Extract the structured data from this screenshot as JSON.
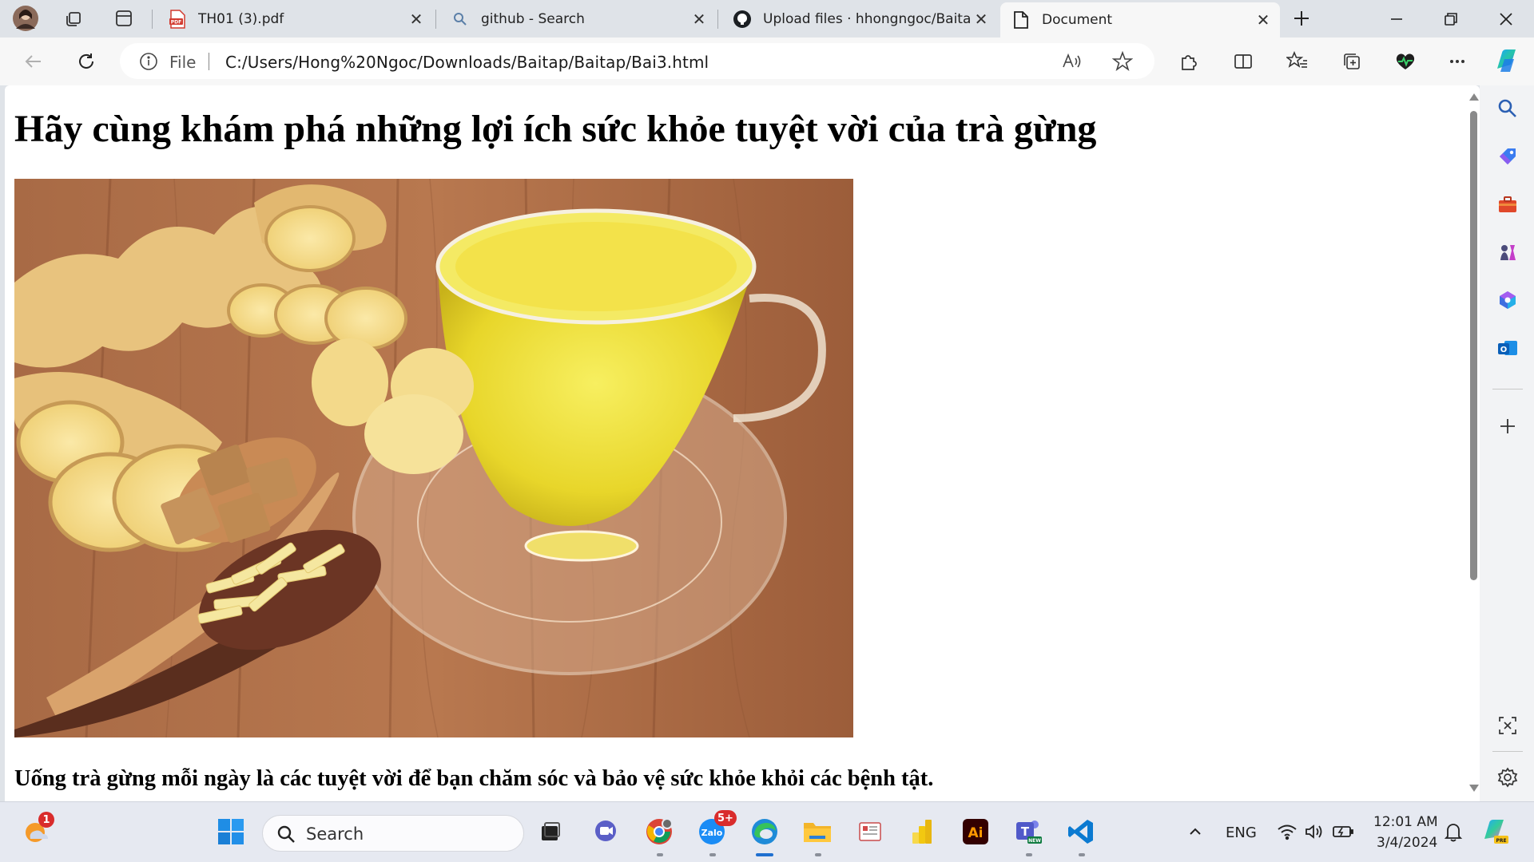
{
  "browser": {
    "tabs": [
      {
        "title": "TH01 (3).pdf",
        "icon": "pdf-icon"
      },
      {
        "title": "github - Search",
        "icon": "search-icon"
      },
      {
        "title": "Upload files · hhongngoc/Baitap",
        "icon": "github-icon"
      },
      {
        "title": "Document",
        "icon": "document-icon",
        "active": true
      }
    ],
    "address": {
      "scheme_label": "File",
      "url": "C:/Users/Hong%20Ngoc/Downloads/Baitap/Baitap/Bai3.html"
    }
  },
  "page": {
    "heading": "Hãy cùng khám phá những lợi ích sức khỏe tuyệt vời của trà gừng",
    "paragraph": "Uống trà gừng mỗi ngày là các tuyệt vời để bạn chăm sóc và bảo vệ sức khỏe khỏi các bệnh tật."
  },
  "taskbar": {
    "search_placeholder": "Search",
    "widget_badge": "1",
    "zalo_badge": "5+",
    "language": "ENG",
    "time": "12:01 AM",
    "date": "3/4/2024"
  },
  "colors": {
    "accent": "#0a66c2",
    "tabbar_bg": "#dfe3e8",
    "toolbar_bg": "#f7f7f7",
    "taskbar_bg": "#e6e9f1"
  }
}
